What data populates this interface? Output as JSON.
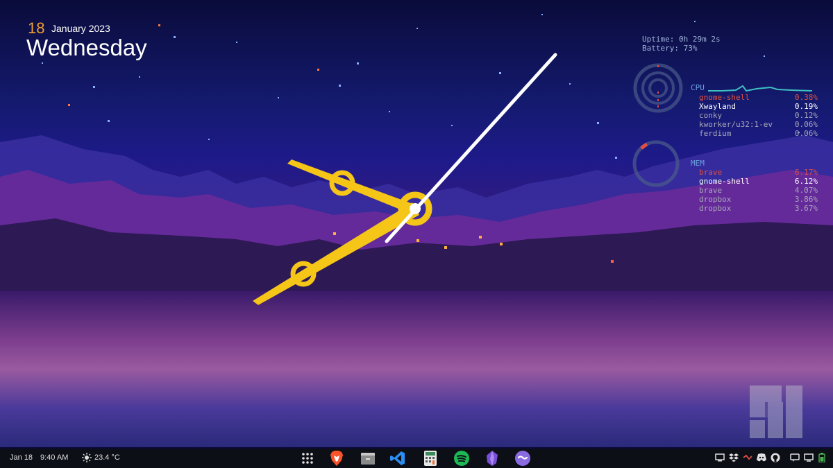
{
  "desktop": {
    "date": {
      "day": "18",
      "month_year": "January 2023",
      "weekday": "Wednesday"
    },
    "sysinfo": {
      "uptime": "Uptime: 0h 29m 2s",
      "battery": "Battery: 73%"
    },
    "cpu": {
      "label": "CPU",
      "processes": [
        {
          "name": "gnome-shell",
          "value": "0.38%"
        },
        {
          "name": "Xwayland",
          "value": "0.19%"
        },
        {
          "name": "conky",
          "value": "0.12%"
        },
        {
          "name": "kworker/u32:1-ev",
          "value": "0.06%"
        },
        {
          "name": "ferdium",
          "value": "0.06%"
        }
      ]
    },
    "mem": {
      "label": "MEM",
      "processes": [
        {
          "name": "brave",
          "value": "6.17%"
        },
        {
          "name": "gnome-shell",
          "value": "6.12%"
        },
        {
          "name": "brave",
          "value": "4.07%"
        },
        {
          "name": "dropbox",
          "value": "3.86%"
        },
        {
          "name": "dropbox",
          "value": "3.67%"
        }
      ]
    },
    "colors": {
      "accent": "#f5c518",
      "highlight": "#e05040",
      "label_blue": "#6aa0e0"
    }
  },
  "taskbar": {
    "date": "Jan 18",
    "time": "9:40 AM",
    "weather": "23.4 °C",
    "weather_icon": "sun-icon",
    "dock": [
      "app-grid-icon",
      "brave-icon",
      "files-icon",
      "vscode-icon",
      "calculator-icon",
      "spotify-icon",
      "obsidian-icon",
      "ferdium-icon"
    ],
    "tray": [
      "screen-share-icon",
      "dropbox-icon",
      "network-icon",
      "discord-icon",
      "github-icon",
      "chat-icon",
      "display-icon",
      "battery-icon"
    ]
  }
}
